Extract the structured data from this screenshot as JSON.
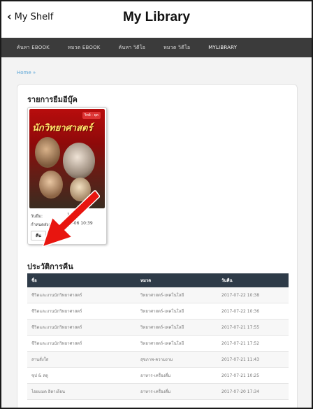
{
  "topbar": {
    "back_label": "My Shelf",
    "title": "My Library"
  },
  "nav": {
    "tabs": [
      {
        "label": "ค้นหา EBOOK",
        "active": false
      },
      {
        "label": "หมวด EBOOK",
        "active": false
      },
      {
        "label": "ค้นหา วิดีโอ",
        "active": false
      },
      {
        "label": "หมวด วิดีโอ",
        "active": false
      },
      {
        "label": "MYLIBRARY",
        "active": true
      }
    ]
  },
  "breadcrumb": "Home »",
  "borrow": {
    "heading": "รายการยืมอีบุ๊ค",
    "book": {
      "cover_title": "นักวิทยาศาสตร์",
      "cover_badge": "วิทย์ - ยุค",
      "borrow_label": "วันยืม:",
      "borrow_value": "10:39",
      "due_label": "กำหนดส่ง:",
      "due_value": "08-06 10:39",
      "return_button": "คืน"
    },
    "annotation_arrow_color": "#e8150f"
  },
  "history": {
    "heading": "ประวัติการคืน",
    "columns": [
      "ชื่อ",
      "หมวด",
      "วันคืน"
    ],
    "rows": [
      [
        "ชีวิตและงานนักวิทยาศาสตร์",
        "วิทยาศาสตร์-เทคโนโลยี",
        "2017-07-22 10:38"
      ],
      [
        "ชีวิตและงานนักวิทยาศาสตร์",
        "วิทยาศาสตร์-เทคโนโลยี",
        "2017-07-22 10:36"
      ],
      [
        "ชีวิตและงานนักวิทยาศาสตร์",
        "วิทยาศาสตร์-เทคโนโลยี",
        "2017-07-21 17:55"
      ],
      [
        "ชีวิตและงานนักวิทยาศาสตร์",
        "วิทยาศาสตร์-เทคโนโลยี",
        "2017-07-21 17:52"
      ],
      [
        "สานสั่งใส",
        "สุขภาพ-ความงาม",
        "2017-07-21 11:43"
      ],
      [
        "ซุป & สตู",
        "อาหาร-เครื่องดื่ม",
        "2017-07-21 10:25"
      ],
      [
        "ไอยแมด อิตาเลียน",
        "อาหาร-เครื่องดื่ม",
        "2017-07-20 17:34"
      ]
    ]
  },
  "colors": {
    "navbar": "#3b3b3b",
    "table_header": "#2e3b48",
    "link": "#5aa5d6"
  }
}
